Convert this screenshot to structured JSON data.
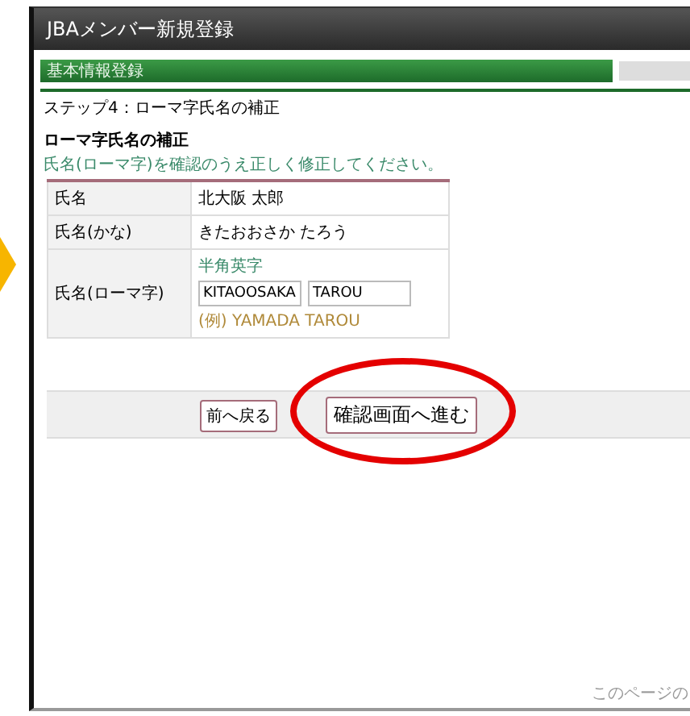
{
  "window": {
    "title": "JBAメンバー新規登録"
  },
  "progress": {
    "steps": [
      {
        "label": "基本情報登録",
        "selected": true
      },
      {
        "selected": false
      }
    ]
  },
  "step_title": "ステップ4：ローマ字氏名の補正",
  "section": {
    "title": "ローマ字氏名の補正",
    "instruction": "氏名(ローマ字)を確認のうえ正しく修正してください。"
  },
  "form": {
    "rows": [
      {
        "kind": "text",
        "label": "氏名",
        "value": "北大阪 太郎"
      },
      {
        "kind": "text",
        "label": "氏名(かな)",
        "value": "きたおおさか たろう"
      },
      {
        "kind": "inputs",
        "label": "氏名(ローマ字)",
        "hint": "半角英字",
        "fields": [
          "KITAOOSAKA",
          "TAROU"
        ],
        "example": "(例) YAMADA TAROU"
      }
    ]
  },
  "buttons": [
    {
      "label": "前へ戻る",
      "highlighted": false
    },
    {
      "label": "確認画面へ進む",
      "highlighted": true
    }
  ],
  "footer": "このページの"
}
